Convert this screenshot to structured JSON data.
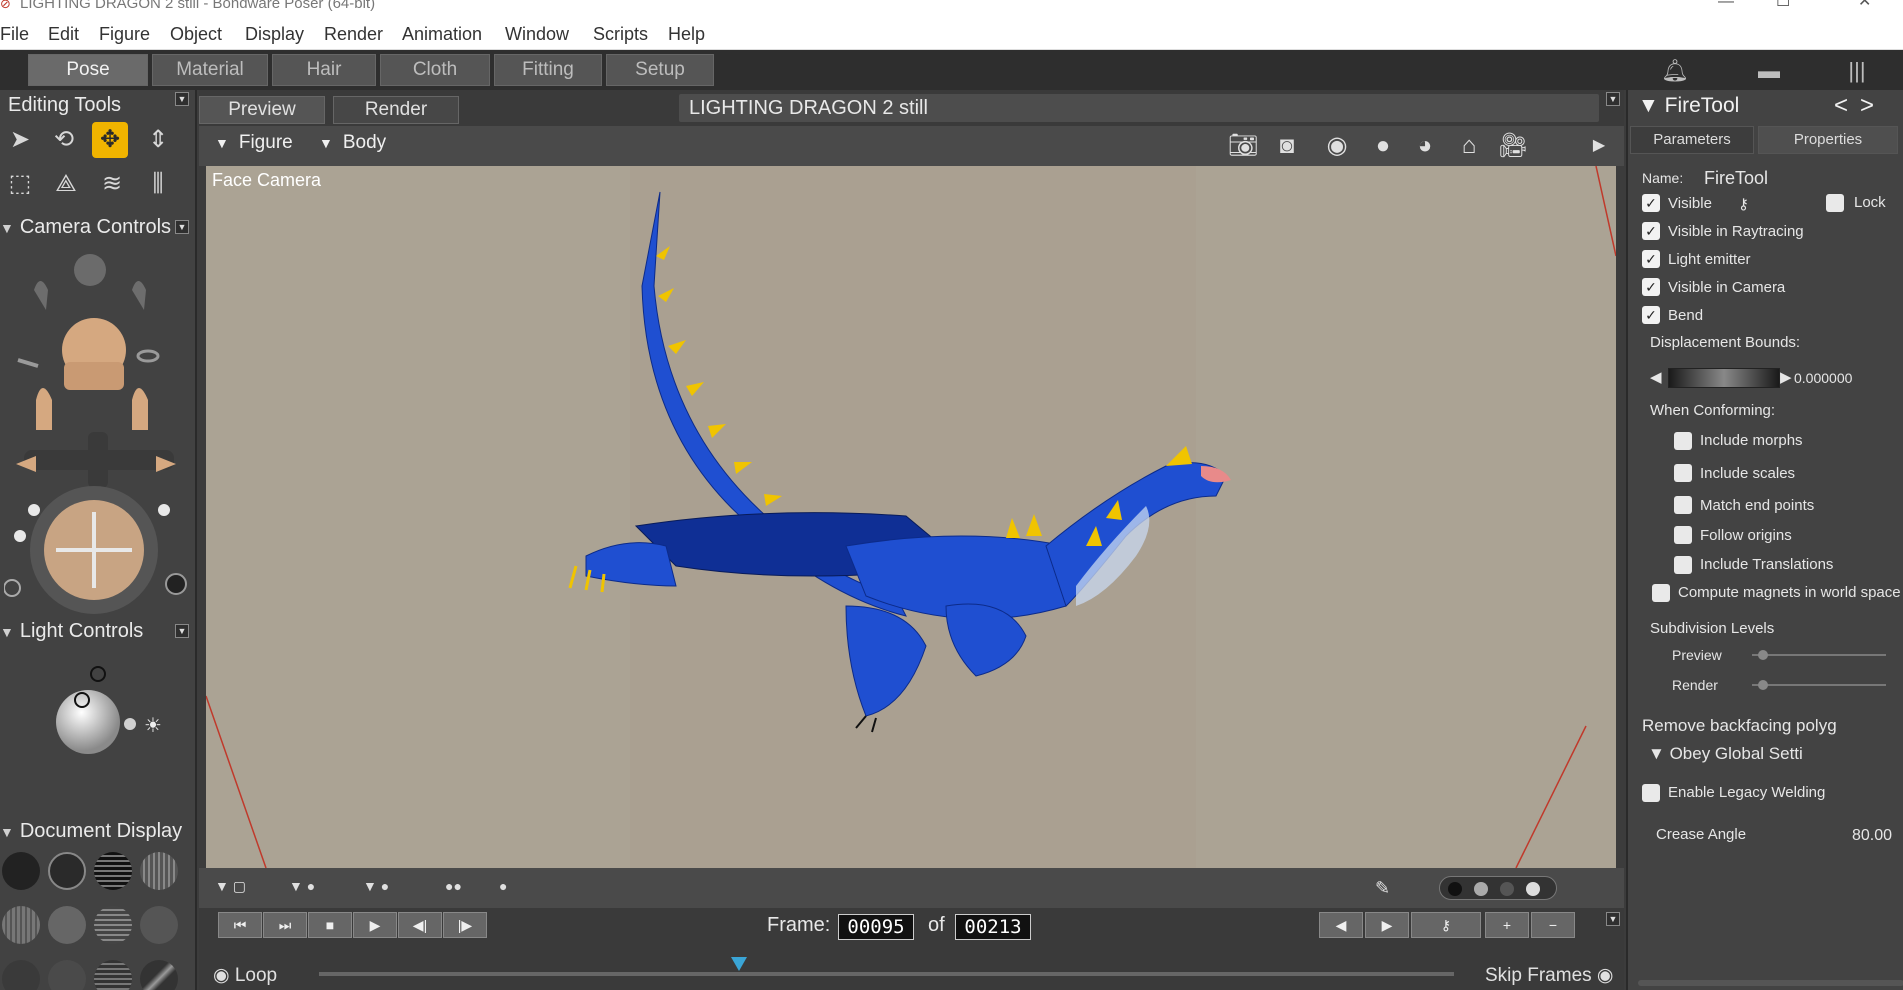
{
  "window": {
    "title": "LIGHTING DRAGON 2 still - Bondware Poser (64-bit)",
    "min_symbol": "—",
    "max_symbol": "☐",
    "close_symbol": "✕"
  },
  "menu": [
    "File",
    "Edit",
    "Figure",
    "Object",
    "Display",
    "Render",
    "Animation",
    "Window",
    "Scripts",
    "Help"
  ],
  "rooms": {
    "tabs": [
      "Pose",
      "Material",
      "Hair",
      "Cloth",
      "Fitting",
      "Setup"
    ],
    "active": "Pose",
    "icons": [
      "bell-icon",
      "chat-icon",
      "library-icon"
    ]
  },
  "left": {
    "editing_tools_title": "Editing Tools",
    "camera_controls_title": "Camera Controls",
    "light_controls_title": "Light Controls",
    "document_display_title": "Document  Display"
  },
  "document": {
    "tabs": [
      "Preview",
      "Render"
    ],
    "active_tab": "Preview",
    "title": "LIGHTING DRAGON 2 still",
    "figure_label": "Figure",
    "body_label": "Body",
    "camera_label": "Face Camera"
  },
  "animation": {
    "frame_label": "Frame:",
    "current_frame": "00095",
    "of_label": "of",
    "total_frames": "00213",
    "loop_label": "Loop",
    "skip_frames_label": "Skip Frames",
    "playhead_fraction": 0.37
  },
  "properties": {
    "panel_title": "FireTool",
    "nav_prev": "<",
    "nav_next": ">",
    "tabs": [
      "Parameters",
      "Properties"
    ],
    "active_tab": "Properties",
    "name_label": "Name:",
    "name_value": "FireTool",
    "visible_label": "Visible",
    "lock_label": "Lock",
    "visible_in_raytracing_label": "Visible in Raytracing",
    "light_emitter_label": "Light emitter",
    "visible_in_camera_label": "Visible in Camera",
    "bend_label": "Bend",
    "displacement_bounds_label": "Displacement Bounds:",
    "displacement_bounds_value": "0.000000",
    "when_conforming_label": "When Conforming:",
    "include_morphs_label": "Include morphs",
    "include_scales_label": "Include scales",
    "match_end_points_label": "Match end points",
    "follow_origins_label": "Follow origins",
    "include_translations_label": "Include Translations",
    "compute_magnets_label": "Compute magnets in world space",
    "subdivision_levels_label": "Subdivision Levels",
    "preview_label": "Preview",
    "render_label": "Render",
    "remove_backfacing_label": "Remove backfacing polyg",
    "obey_global_label": "Obey Global Setti",
    "enable_legacy_welding_label": "Enable Legacy Welding",
    "crease_angle_label": "Crease Angle",
    "crease_angle_value": "80.00",
    "checked_visible": true,
    "checked_lock": false,
    "checked_raytracing": true,
    "checked_light_emitter": true,
    "checked_visible_camera": true,
    "checked_bend": true
  },
  "colors": {
    "dragon_body": "#1f4fd1",
    "dragon_spikes": "#f0c400",
    "accent_active_tool": "#f0b400",
    "playhead": "#3aa5d6"
  }
}
